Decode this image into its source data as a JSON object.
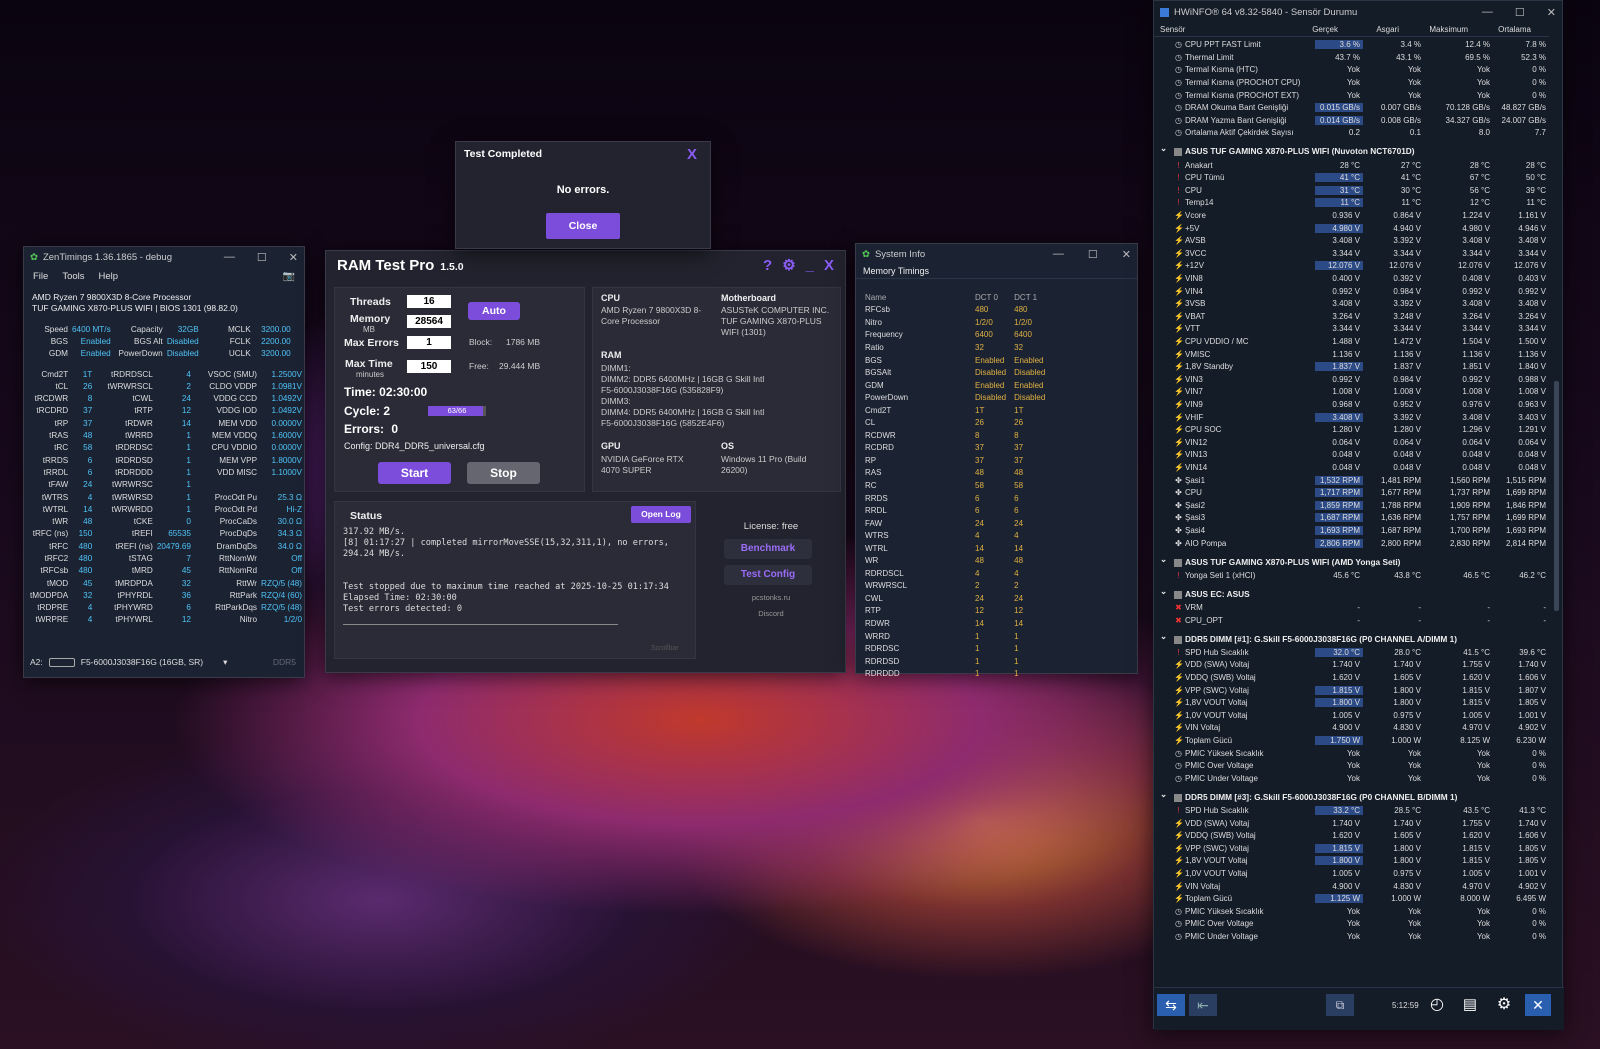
{
  "zen": {
    "title": "ZenTimings 1.36.1865 - debug",
    "menu": [
      "File",
      "Tools",
      "Help"
    ],
    "cpu": "AMD Ryzen 7 9800X3D 8-Core Processor",
    "board": "TUF GAMING X870-PLUS WIFI | BIOS 1301 (98.82.0)",
    "top": [
      [
        "Speed",
        "6400 MT/s",
        "Capacity",
        "32GB",
        "MCLK",
        "3200.00"
      ],
      [
        "BGS",
        "Enabled",
        "BGS Alt",
        "Disabled",
        "FCLK",
        "2200.00"
      ],
      [
        "GDM",
        "Enabled",
        "PowerDown",
        "Disabled",
        "UCLK",
        "3200.00"
      ]
    ],
    "rows": [
      [
        "Cmd2T",
        "1T",
        "tRDRDSCL",
        "4",
        "VSOC (SMU)",
        "1.2500V"
      ],
      [
        "tCL",
        "26",
        "tWRWRSCL",
        "2",
        "CLDO VDDP",
        "1.0981V"
      ],
      [
        "tRCDWR",
        "8",
        "tCWL",
        "24",
        "VDDG CCD",
        "1.0492V"
      ],
      [
        "tRCDRD",
        "37",
        "tRTP",
        "12",
        "VDDG IOD",
        "1.0492V"
      ],
      [
        "tRP",
        "37",
        "tRDWR",
        "14",
        "MEM VDD",
        "0.0000V"
      ],
      [
        "tRAS",
        "48",
        "tWRRD",
        "1",
        "MEM VDDQ",
        "1.6000V"
      ],
      [
        "tRC",
        "58",
        "tRDRDSC",
        "1",
        "CPU VDDIO",
        "0.0000V"
      ],
      [
        "tRRDS",
        "6",
        "tRDRDSD",
        "1",
        "MEM VPP",
        "1.8000V"
      ],
      [
        "tRRDL",
        "6",
        "tRDRDDD",
        "1",
        "VDD MISC",
        "1.1000V"
      ],
      [
        "tFAW",
        "24",
        "tWRWRSC",
        "1",
        "",
        ""
      ],
      [
        "tWTRS",
        "4",
        "tWRWRSD",
        "1",
        "ProcOdt Pu",
        "25.3 Ω"
      ],
      [
        "tWTRL",
        "14",
        "tWRWRDD",
        "1",
        "ProcOdt Pd",
        "Hi-Z"
      ],
      [
        "tWR",
        "48",
        "tCKE",
        "0",
        "ProcCaDs",
        "30.0 Ω"
      ],
      [
        "tRFC (ns)",
        "150",
        "tREFI",
        "65535",
        "ProcDqDs",
        "34.3 Ω"
      ],
      [
        "tRFC",
        "480",
        "tREFI (ns)",
        "20479.69",
        "DramDqDs",
        "34.0 Ω"
      ],
      [
        "tRFC2",
        "480",
        "tSTAG",
        "7",
        "RttNomWr",
        "Off"
      ],
      [
        "tRFCsb",
        "480",
        "tMRD",
        "45",
        "RttNomRd",
        "Off"
      ],
      [
        "tMOD",
        "45",
        "tMRDPDA",
        "32",
        "RttWr",
        "RZQ/5 (48)"
      ],
      [
        "tMODPDA",
        "32",
        "tPHYRDL",
        "36",
        "RttPark",
        "RZQ/4 (60)"
      ],
      [
        "tRDPRE",
        "4",
        "tPHYWRD",
        "6",
        "RttParkDqs",
        "RZQ/5 (48)"
      ],
      [
        "tWRPRE",
        "4",
        "tPHYWRL",
        "12",
        "Nitro",
        "1/2/0"
      ]
    ],
    "slot": "A2:",
    "module": "F5-6000J3038F16G (16GB, SR)",
    "type": "DDR5"
  },
  "rtp": {
    "title": "RAM Test Pro",
    "version": "1.5.0",
    "threads_label": "Threads",
    "threads": "16",
    "auto": "Auto",
    "memory_label": "Memory",
    "memory_unit": "MB",
    "memory": "28564",
    "maxerr_label": "Max Errors",
    "maxerr": "1",
    "block_label": "Block:",
    "block": "1786 MB",
    "maxtime_label": "Max Time",
    "maxtime_unit": "minutes",
    "maxtime": "150",
    "free_label": "Free:",
    "free": "29.444 MB",
    "time_label": "Time:",
    "time": "02:30:00",
    "cycle_label": "Cycle:",
    "cycle": "2",
    "progress": "63/66",
    "progress_frac": 0.955,
    "errors_label": "Errors:",
    "errors": "0",
    "config": "Config: DDR4_DDR5_universal.cfg",
    "start": "Start",
    "stop": "Stop",
    "cpu_h": "CPU",
    "cpu": "AMD Ryzen 7 9800X3D 8-Core Processor",
    "mb_h": "Motherboard",
    "mb": "ASUSTeK COMPUTER INC. TUF GAMING X870-PLUS WIFI (1301)",
    "ram_h": "RAM",
    "ram": "DIMM1:\nDIMM2: DDR5 6400MHz | 16GB G Skill Intl\nF5-6000J3038F16G (535828F9)\nDIMM3:\nDIMM4: DDR5 6400MHz | 16GB G Skill Intl\nF5-6000J3038F16G (5852E4F6)",
    "gpu_h": "GPU",
    "gpu": "NVIDIA GeForce RTX 4070 SUPER",
    "os_h": "OS",
    "os": "Windows 11 Pro (Build 26200)",
    "status_h": "Status",
    "openlog": "Open Log",
    "log": "317.92 MB/s.\n[8] 01:17:27 | completed mirrorMoveSSE(15,32,311,1), no errors,\n294.24 MB/s.\n\n\nTest stopped due to maximum time reached at 2025-10-25 01:17:34\nElapsed Time: 02:30:00\nTest errors detected: 0",
    "scrollbar": "Scrollbar",
    "license": "License: free",
    "benchmark": "Benchmark",
    "testconfig": "Test Config",
    "site": "pcstonks.ru",
    "discord": "Discord"
  },
  "dialog": {
    "title": "Test Completed",
    "message": "No errors.",
    "close": "Close"
  },
  "sysinfo": {
    "title": "System Info",
    "tab": "Memory Timings",
    "cols": [
      "Name",
      "DCT 0",
      "DCT 1"
    ],
    "rows": [
      [
        "RFCsb",
        "480",
        "480"
      ],
      [
        "Nitro",
        "1/2/0",
        "1/2/0"
      ],
      [
        "Frequency",
        "6400",
        "6400"
      ],
      [
        "Ratio",
        "32",
        "32"
      ],
      [
        "BGS",
        "Enabled",
        "Enabled"
      ],
      [
        "BGSAlt",
        "Disabled",
        "Disabled"
      ],
      [
        "GDM",
        "Enabled",
        "Enabled"
      ],
      [
        "PowerDown",
        "Disabled",
        "Disabled"
      ],
      [
        "Cmd2T",
        "1T",
        "1T"
      ],
      [
        "CL",
        "26",
        "26"
      ],
      [
        "RCDWR",
        "8",
        "8"
      ],
      [
        "RCDRD",
        "37",
        "37"
      ],
      [
        "RP",
        "37",
        "37"
      ],
      [
        "RAS",
        "48",
        "48"
      ],
      [
        "RC",
        "58",
        "58"
      ],
      [
        "RRDS",
        "6",
        "6"
      ],
      [
        "RRDL",
        "6",
        "6"
      ],
      [
        "FAW",
        "24",
        "24"
      ],
      [
        "WTRS",
        "4",
        "4"
      ],
      [
        "WTRL",
        "14",
        "14"
      ],
      [
        "WR",
        "48",
        "48"
      ],
      [
        "RDRDSCL",
        "4",
        "4"
      ],
      [
        "WRWRSCL",
        "2",
        "2"
      ],
      [
        "CWL",
        "24",
        "24"
      ],
      [
        "RTP",
        "12",
        "12"
      ],
      [
        "RDWR",
        "14",
        "14"
      ],
      [
        "WRRD",
        "1",
        "1"
      ],
      [
        "RDRDSC",
        "1",
        "1"
      ],
      [
        "RDRDSD",
        "1",
        "1"
      ],
      [
        "RDRDDD",
        "1",
        "1"
      ]
    ]
  },
  "hwinfo": {
    "title": "HWiNFO® 64 v8.32-5840 - Sensör Durumu",
    "cols": [
      "Sensör",
      "Gerçek",
      "Asgari",
      "Maksimum",
      "Ortalama"
    ],
    "items": [
      [
        "r",
        "CPU PPT FAST Limit",
        "3.6 %",
        "3.4 %",
        "12.4 %",
        "7.8 %",
        1
      ],
      [
        "r",
        "Thermal Limit",
        "43.7 %",
        "43.1 %",
        "69.5 %",
        "52.3 %",
        0
      ],
      [
        "r",
        "Termal Kısma (HTC)",
        "Yok",
        "Yok",
        "Yok",
        "0 %",
        0
      ],
      [
        "r",
        "Termal Kısma (PROCHOT CPU)",
        "Yok",
        "Yok",
        "Yok",
        "0 %",
        0
      ],
      [
        "r",
        "Termal Kısma (PROCHOT EXT)",
        "Yok",
        "Yok",
        "Yok",
        "0 %",
        0
      ],
      [
        "r",
        "DRAM Okuma Bant Genişliği",
        "0.015 GB/s",
        "0.007 GB/s",
        "70.128 GB/s",
        "48.827 GB/s",
        1
      ],
      [
        "r",
        "DRAM Yazma Bant Genişliği",
        "0.014 GB/s",
        "0.008 GB/s",
        "34.327 GB/s",
        "24.007 GB/s",
        1
      ],
      [
        "r",
        "Ortalama Aktif Çekirdek Sayısı",
        "0.2",
        "0.1",
        "8.0",
        "7.7",
        0
      ],
      [
        "g",
        "ASUS TUF GAMING X870-PLUS WIFI (Nuvoton NCT6701D)"
      ],
      [
        "t",
        "Anakart",
        "28 °C",
        "27 °C",
        "28 °C",
        "28 °C",
        0
      ],
      [
        "t",
        "CPU Tümü",
        "41 °C",
        "41 °C",
        "67 °C",
        "50 °C",
        1
      ],
      [
        "t",
        "CPU",
        "31 °C",
        "30 °C",
        "56 °C",
        "39 °C",
        1
      ],
      [
        "t",
        "Temp14",
        "11 °C",
        "11 °C",
        "12 °C",
        "11 °C",
        1
      ],
      [
        "v",
        "Vcore",
        "0.936 V",
        "0.864 V",
        "1.224 V",
        "1.161 V",
        0
      ],
      [
        "v",
        "+5V",
        "4.980 V",
        "4.940 V",
        "4.980 V",
        "4.946 V",
        1
      ],
      [
        "v",
        "AVSB",
        "3.408 V",
        "3.392 V",
        "3.408 V",
        "3.408 V",
        0
      ],
      [
        "v",
        "3VCC",
        "3.344 V",
        "3.344 V",
        "3.344 V",
        "3.344 V",
        0
      ],
      [
        "v",
        "+12V",
        "12.076 V",
        "12.076 V",
        "12.076 V",
        "12.076 V",
        1
      ],
      [
        "v",
        "VIN8",
        "0.400 V",
        "0.392 V",
        "0.408 V",
        "0.403 V",
        0
      ],
      [
        "v",
        "VIN4",
        "0.992 V",
        "0.984 V",
        "0.992 V",
        "0.992 V",
        0
      ],
      [
        "v",
        "3VSB",
        "3.408 V",
        "3.392 V",
        "3.408 V",
        "3.408 V",
        0
      ],
      [
        "v",
        "VBAT",
        "3.264 V",
        "3.248 V",
        "3.264 V",
        "3.264 V",
        0
      ],
      [
        "v",
        "VTT",
        "3.344 V",
        "3.344 V",
        "3.344 V",
        "3.344 V",
        0
      ],
      [
        "v",
        "CPU VDDIO / MC",
        "1.488 V",
        "1.472 V",
        "1.504 V",
        "1.500 V",
        0
      ],
      [
        "v",
        "VMISC",
        "1.136 V",
        "1.136 V",
        "1.136 V",
        "1.136 V",
        0
      ],
      [
        "v",
        "1,8V Standby",
        "1.837 V",
        "1.837 V",
        "1.851 V",
        "1.840 V",
        1
      ],
      [
        "v",
        "VIN3",
        "0.992 V",
        "0.984 V",
        "0.992 V",
        "0.988 V",
        0
      ],
      [
        "v",
        "VIN7",
        "1.008 V",
        "1.008 V",
        "1.008 V",
        "1.008 V",
        0
      ],
      [
        "v",
        "VIN9",
        "0.968 V",
        "0.952 V",
        "0.976 V",
        "0.963 V",
        0
      ],
      [
        "v",
        "VHIF",
        "3.408 V",
        "3.392 V",
        "3.408 V",
        "3.403 V",
        1
      ],
      [
        "v",
        "CPU SOC",
        "1.280 V",
        "1.280 V",
        "1.296 V",
        "1.291 V",
        0
      ],
      [
        "v",
        "VIN12",
        "0.064 V",
        "0.064 V",
        "0.064 V",
        "0.064 V",
        0
      ],
      [
        "v",
        "VIN13",
        "0.048 V",
        "0.048 V",
        "0.048 V",
        "0.048 V",
        0
      ],
      [
        "v",
        "VIN14",
        "0.048 V",
        "0.048 V",
        "0.048 V",
        "0.048 V",
        0
      ],
      [
        "f",
        "Şasi1",
        "1,532 RPM",
        "1,481 RPM",
        "1,560 RPM",
        "1,515 RPM",
        1
      ],
      [
        "f",
        "CPU",
        "1,717 RPM",
        "1,677 RPM",
        "1,737 RPM",
        "1,699 RPM",
        1
      ],
      [
        "f",
        "Şasi2",
        "1,859 RPM",
        "1,788 RPM",
        "1,909 RPM",
        "1,846 RPM",
        1
      ],
      [
        "f",
        "Şasi3",
        "1,687 RPM",
        "1,636 RPM",
        "1,757 RPM",
        "1,699 RPM",
        1
      ],
      [
        "f",
        "Şasi4",
        "1,693 RPM",
        "1,687 RPM",
        "1,700 RPM",
        "1,693 RPM",
        1
      ],
      [
        "f",
        "AIO Pompa",
        "2,806 RPM",
        "2,800 RPM",
        "2,830 RPM",
        "2,814 RPM",
        1
      ],
      [
        "g",
        "ASUS TUF GAMING X870-PLUS WIFI (AMD Yonga Seti)"
      ],
      [
        "t",
        "Yonga Seti 1 (xHCI)",
        "45.6 °C",
        "43.8 °C",
        "46.5 °C",
        "46.2 °C",
        0
      ],
      [
        "g",
        "ASUS EC: ASUS"
      ],
      [
        "x",
        "VRM",
        "-",
        "-",
        "-",
        "-",
        0
      ],
      [
        "x",
        "CPU_OPT",
        "-",
        "-",
        "-",
        "-",
        0
      ],
      [
        "g",
        "DDR5 DIMM [#1]: G.Skill F5-6000J3038F16G (P0 CHANNEL A/DIMM 1)"
      ],
      [
        "t",
        "SPD Hub Sıcaklık",
        "32.0 °C",
        "28.0 °C",
        "41.5 °C",
        "39.6 °C",
        1
      ],
      [
        "v",
        "VDD (SWA) Voltaj",
        "1.740 V",
        "1.740 V",
        "1.755 V",
        "1.740 V",
        0
      ],
      [
        "v",
        "VDDQ (SWB) Voltaj",
        "1.620 V",
        "1.605 V",
        "1.620 V",
        "1.606 V",
        0
      ],
      [
        "v",
        "VPP (SWC) Voltaj",
        "1.815 V",
        "1.800 V",
        "1.815 V",
        "1.807 V",
        1
      ],
      [
        "v",
        "1,8V VOUT Voltaj",
        "1.800 V",
        "1.800 V",
        "1.815 V",
        "1.805 V",
        1
      ],
      [
        "v",
        "1,0V VOUT Voltaj",
        "1.005 V",
        "0.975 V",
        "1.005 V",
        "1.001 V",
        0
      ],
      [
        "v",
        "VIN Voltaj",
        "4.900 V",
        "4.830 V",
        "4.970 V",
        "4.902 V",
        0
      ],
      [
        "v",
        "Toplam Gücü",
        "1.750 W",
        "1.000 W",
        "8.125 W",
        "6.230 W",
        1
      ],
      [
        "r",
        "PMIC Yüksek Sıcaklık",
        "Yok",
        "Yok",
        "Yok",
        "0 %",
        0
      ],
      [
        "r",
        "PMIC Over Voltage",
        "Yok",
        "Yok",
        "Yok",
        "0 %",
        0
      ],
      [
        "r",
        "PMIC Under Voltage",
        "Yok",
        "Yok",
        "Yok",
        "0 %",
        0
      ],
      [
        "g",
        "DDR5 DIMM [#3]: G.Skill F5-6000J3038F16G (P0 CHANNEL B/DIMM 1)"
      ],
      [
        "t",
        "SPD Hub Sıcaklık",
        "33.2 °C",
        "28.5 °C",
        "43.5 °C",
        "41.3 °C",
        1
      ],
      [
        "v",
        "VDD (SWA) Voltaj",
        "1.740 V",
        "1.740 V",
        "1.755 V",
        "1.740 V",
        0
      ],
      [
        "v",
        "VDDQ (SWB) Voltaj",
        "1.620 V",
        "1.605 V",
        "1.620 V",
        "1.606 V",
        0
      ],
      [
        "v",
        "VPP (SWC) Voltaj",
        "1.815 V",
        "1.800 V",
        "1.815 V",
        "1.805 V",
        1
      ],
      [
        "v",
        "1,8V VOUT Voltaj",
        "1.800 V",
        "1.800 V",
        "1.815 V",
        "1.805 V",
        1
      ],
      [
        "v",
        "1,0V VOUT Voltaj",
        "1.005 V",
        "0.975 V",
        "1.005 V",
        "1.001 V",
        0
      ],
      [
        "v",
        "VIN Voltaj",
        "4.900 V",
        "4.830 V",
        "4.970 V",
        "4.902 V",
        0
      ],
      [
        "v",
        "Toplam Gücü",
        "1.125 W",
        "1.000 W",
        "8.000 W",
        "6.495 W",
        1
      ],
      [
        "r",
        "PMIC Yüksek Sıcaklık",
        "Yok",
        "Yok",
        "Yok",
        "0 %",
        0
      ],
      [
        "r",
        "PMIC Over Voltage",
        "Yok",
        "Yok",
        "Yok",
        "0 %",
        0
      ],
      [
        "r",
        "PMIC Under Voltage",
        "Yok",
        "Yok",
        "Yok",
        "0 %",
        0
      ]
    ],
    "clock": "5:12:59"
  },
  "colors": {
    "accent": "#7c4ddb",
    "value": "#4fc3f7",
    "hw_hl": "#2c4a86"
  }
}
